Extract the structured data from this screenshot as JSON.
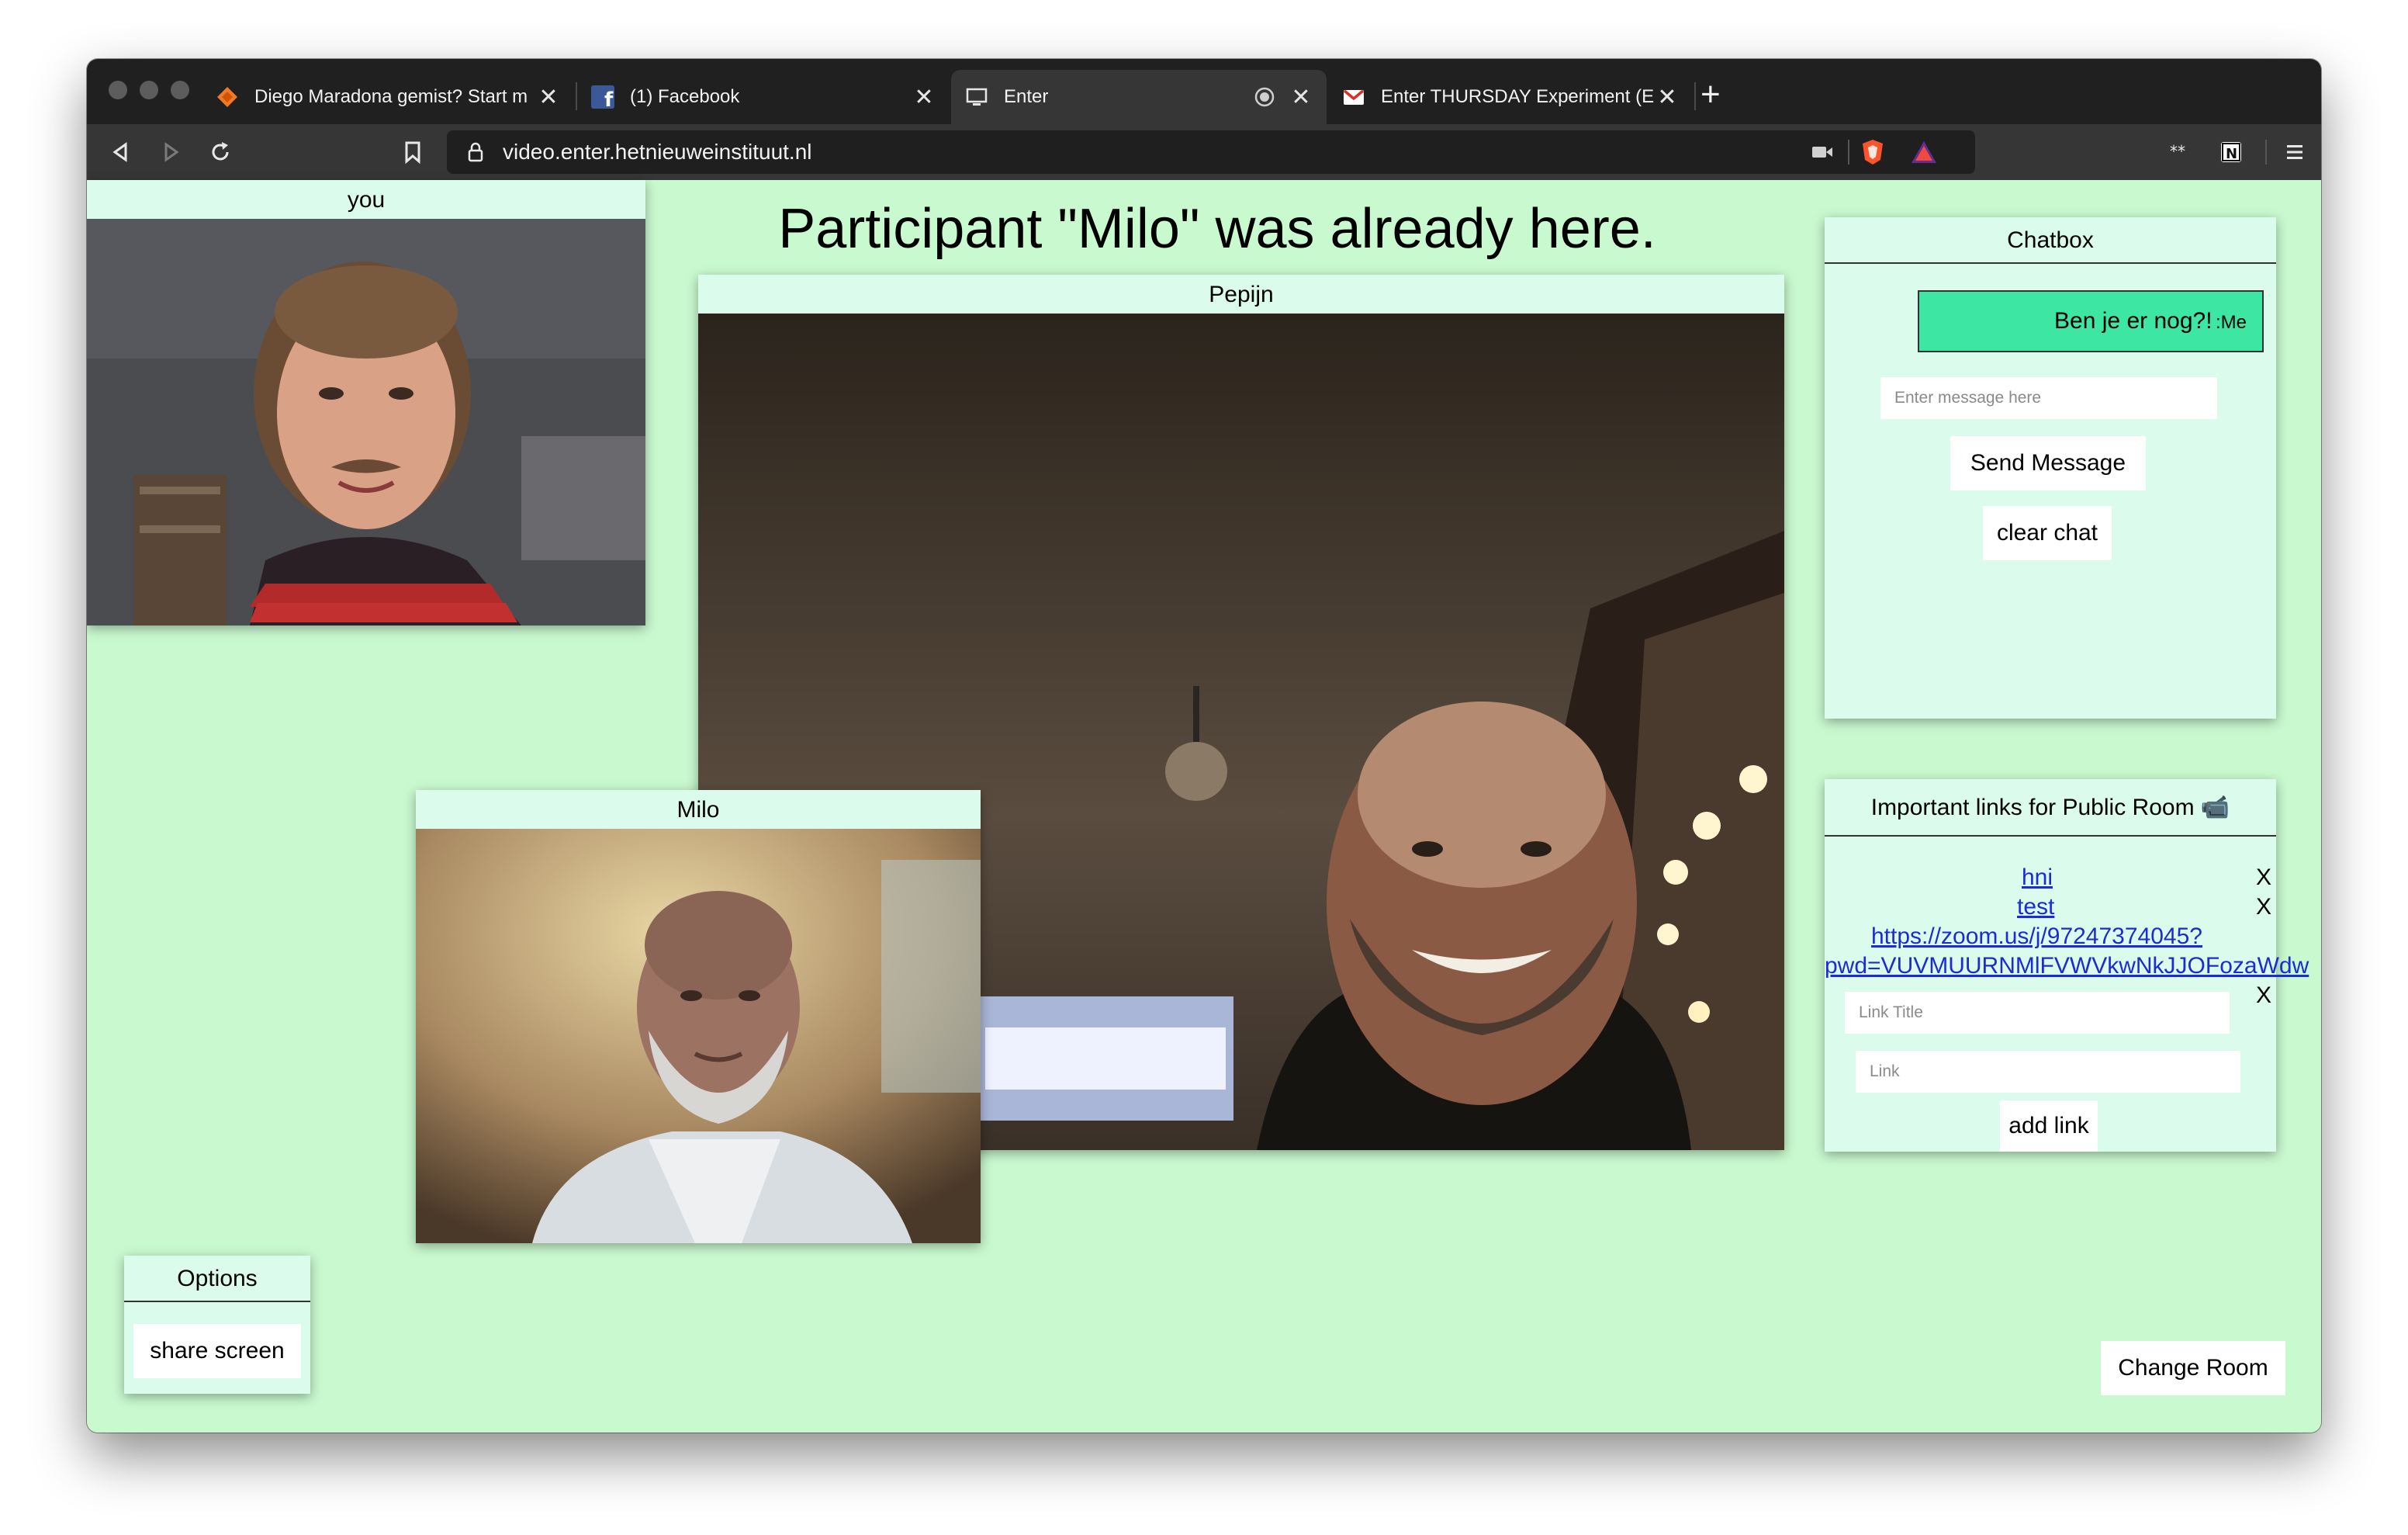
{
  "browser": {
    "tabs": [
      {
        "title": "Diego Maradona gemist? Start m",
        "icon": "brave-orange-icon"
      },
      {
        "title": "(1) Facebook",
        "icon": "facebook-icon"
      },
      {
        "title": "Enter",
        "icon": "monitor-icon"
      },
      {
        "title": "Enter THURSDAY Experiment (E",
        "icon": "gmail-icon"
      }
    ],
    "url": "video.enter.hetnieuweinstituut.nl",
    "close_glyph": "✕",
    "new_tab_glyph": "+"
  },
  "page": {
    "status_message": "Participant \"Milo\" was already here.",
    "self_video_label": "you",
    "main_video_label": "Pepijn",
    "second_video_label": "Milo"
  },
  "chatbox": {
    "title": "Chatbox",
    "messages": [
      {
        "text": "Ben je er nog?!",
        "sender": ":Me"
      }
    ],
    "input_placeholder": "Enter message here",
    "send_label": "Send Message",
    "clear_label": "clear chat"
  },
  "links_panel": {
    "title": "Important links for Public Room 📹",
    "links": [
      {
        "text": "hni",
        "remove": "X"
      },
      {
        "text": "test",
        "remove": "X"
      },
      {
        "text": "https://zoom.us/j/97247374045?",
        "text2": "pwd=VUVMUURNMlFVWVkwNkJJOFozaWdw",
        "remove": "X"
      }
    ],
    "title_placeholder": "Link Title",
    "link_placeholder": "Link",
    "add_label": "add link"
  },
  "options": {
    "title": "Options",
    "share_label": "share screen"
  },
  "change_room_label": "Change Room",
  "colors": {
    "page_bg": "#c9f9cf",
    "panel_bg": "#dbfcec",
    "chat_bubble": "#3ee6a4",
    "link": "#1b2bd6"
  }
}
